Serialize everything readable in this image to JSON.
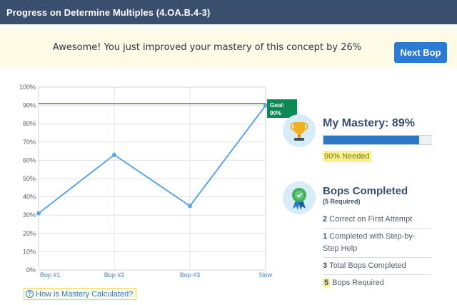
{
  "header": {
    "title": "Progress on Determine Multiples (4.OA.B.4-3)"
  },
  "banner": {
    "message": "Awesome! You just improved your mastery of this concept by 26%",
    "next_button": "Next Bop"
  },
  "chart_data": {
    "type": "line",
    "categories": [
      "Bop #1",
      "Bop #2",
      "Bop #3",
      "Now"
    ],
    "values": [
      31,
      63,
      35,
      90
    ],
    "y_ticks": [
      "0%",
      "10%",
      "20%",
      "30%",
      "40%",
      "50%",
      "60%",
      "70%",
      "80%",
      "90%",
      "100%"
    ],
    "ylim": [
      0,
      100
    ],
    "goal": {
      "value": 91,
      "label_line1": "Goal:",
      "label_line2": "90%"
    },
    "grid": true,
    "colors": {
      "series": "#5da6e6",
      "goal": "#4fbf5a",
      "goal_label_bg": "#0c8a55"
    }
  },
  "help": {
    "label": "How is Mastery Calculated?",
    "icon": "question-icon"
  },
  "mastery": {
    "icon": "trophy-icon",
    "title": "My Mastery: 89%",
    "progress": 0.89,
    "needed": "90% Needed"
  },
  "bops": {
    "icon": "award-ribbon-icon",
    "title": "Bops Completed",
    "required_note": "(5 Required)",
    "items": [
      {
        "num": "2",
        "text": "Correct on First Attempt"
      },
      {
        "num": "1",
        "text": "Completed with Step-by-Step Help"
      },
      {
        "num": "3",
        "text": "Total Bops Completed"
      },
      {
        "num": "5",
        "text": "Bops Required"
      }
    ]
  }
}
